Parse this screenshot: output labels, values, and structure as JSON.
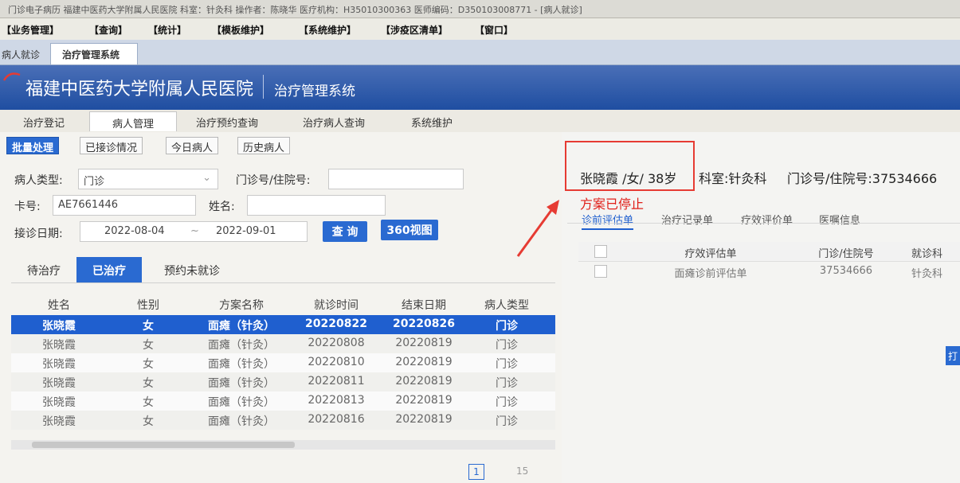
{
  "window_title": "门诊电子病历  福建中医药大学附属人民医院  科室：针灸科  操作者：陈晓华  医疗机构：H35010300363  医师编码：D350103008771 - [病人就诊]",
  "menu": [
    "【业务管理】",
    "【查询】",
    "【统计】",
    "【模板维护】",
    "【系统维护】",
    "【涉疫区清单】",
    "【窗口】"
  ],
  "doc_tabs": [
    "病人就诊",
    "治疗管理系统"
  ],
  "banner": {
    "hospital": "福建中医药大学附属人民医院",
    "system": "治疗管理系统"
  },
  "main_tabs": [
    "治疗登记",
    "病人管理",
    "治疗预约查询",
    "治疗病人查询",
    "系统维护"
  ],
  "sub_buttons": [
    "批量处理",
    "已接诊情况",
    "今日病人",
    "历史病人"
  ],
  "search": {
    "patient_type_label": "病人类型:",
    "patient_type_value": "门诊",
    "reg_no_label": "门诊号/住院号:",
    "card_label": "卡号:",
    "card_value": "AE7661446",
    "name_label": "姓名:",
    "date_label": "接诊日期:",
    "date_from": "2022-08-04",
    "date_sep": "~",
    "date_to": "2022-09-01",
    "query_button": "查 询",
    "view360_button": "360视图"
  },
  "treat_tabs": [
    "待治疗",
    "已治疗",
    "预约未就诊"
  ],
  "table": {
    "headers": [
      "姓名",
      "性别",
      "方案名称",
      "就诊时间",
      "结束日期",
      "病人类型"
    ],
    "rows": [
      [
        "张晓霞",
        "女",
        "面瘫（针灸）",
        "20220822",
        "20220826",
        "门诊"
      ],
      [
        "张晓霞",
        "女",
        "面瘫（针灸）",
        "20220808",
        "20220819",
        "门诊"
      ],
      [
        "张晓霞",
        "女",
        "面瘫（针灸）",
        "20220810",
        "20220819",
        "门诊"
      ],
      [
        "张晓霞",
        "女",
        "面瘫（针灸）",
        "20220811",
        "20220819",
        "门诊"
      ],
      [
        "张晓霞",
        "女",
        "面瘫（针灸）",
        "20220813",
        "20220819",
        "门诊"
      ],
      [
        "张晓霞",
        "女",
        "面瘫（针灸）",
        "20220816",
        "20220819",
        "门诊"
      ]
    ],
    "selected_index": 0
  },
  "pager": {
    "current": "1",
    "size": "15"
  },
  "right": {
    "patient": "张晓霞 /女/ 38岁",
    "dept": "科室:针灸科",
    "reg_no": "门诊号/住院号:37534666",
    "status": "方案已停止",
    "tabs": [
      "诊前评估单",
      "治疗记录单",
      "疗效评价单",
      "医嘱信息"
    ],
    "table_headers": [
      "疗效评估单",
      "门诊/住院号",
      "就诊科"
    ],
    "table_rows": [
      [
        "面瘫诊前评估单",
        "37534666",
        "针灸科"
      ]
    ],
    "edge_button": "打"
  },
  "colors": {
    "primary": "#2a6ad1",
    "banner": "#1f4ea1",
    "alert_red": "#e0201a",
    "highlight_box": "#e63b33"
  }
}
